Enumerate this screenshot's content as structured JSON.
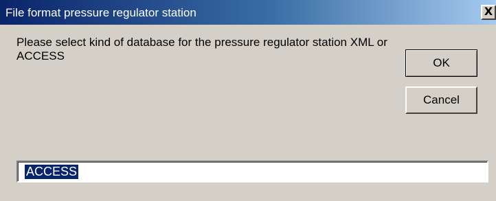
{
  "window": {
    "title": "File format pressure regulator station",
    "close_glyph": "X"
  },
  "message": {
    "text": "Please select kind of database for the pressure regulator station XML or ACCESS"
  },
  "buttons": {
    "ok_label": "OK",
    "cancel_label": "Cancel"
  },
  "input": {
    "value": "ACCESS"
  },
  "colors": {
    "titlebar_start": "#0a246a",
    "titlebar_end": "#a6caf0",
    "dialog_bg": "#d4d0c8",
    "selection_bg": "#0a246a"
  }
}
